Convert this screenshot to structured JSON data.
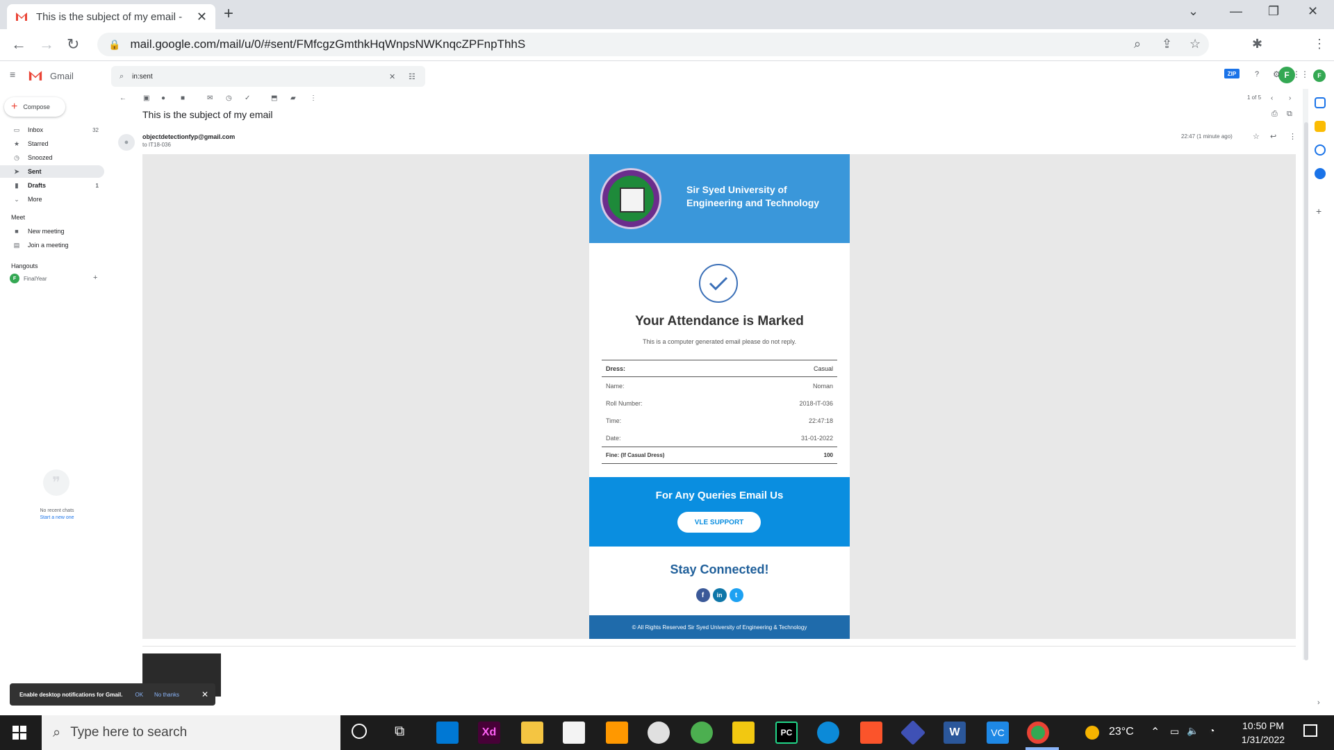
{
  "browser": {
    "tab_title": "This is the subject of my email - ",
    "url": "mail.google.com/mail/u/0/#sent/FMfcgzGmthkHqWnpsNWKnqcZPFnpThhS",
    "profile_initial": "F",
    "zip_badge": "ZIP"
  },
  "gmail": {
    "logo_text": "Gmail",
    "search_value": "in:sent",
    "compose_label": "Compose",
    "nav": [
      {
        "label": "Inbox",
        "count": "32"
      },
      {
        "label": "Starred",
        "count": ""
      },
      {
        "label": "Snoozed",
        "count": ""
      },
      {
        "label": "Sent",
        "count": ""
      },
      {
        "label": "Drafts",
        "count": "1"
      },
      {
        "label": "More",
        "count": ""
      }
    ],
    "meet_header": "Meet",
    "meet_items": [
      "New meeting",
      "Join a meeting"
    ],
    "hangouts_header": "Hangouts",
    "hangouts_user": "FinalYear",
    "no_chats": "No recent chats",
    "start_new": "Start a new one",
    "pager": "1 of 5"
  },
  "message": {
    "subject": "This is the subject of my email",
    "sender": "objectdetectionfyp@gmail.com",
    "recipient": "to IT18-036",
    "time": "22:47 (1 minute ago)"
  },
  "email": {
    "university": "Sir Syed University of Engineering and Technology",
    "heading": "Your Attendance is Marked",
    "note": "This is a computer generated email please do not reply.",
    "rows": [
      {
        "label": "Dress:",
        "value": "Casual"
      },
      {
        "label": "Name:",
        "value": "Noman"
      },
      {
        "label": "Roll Number:",
        "value": "2018-IT-036"
      },
      {
        "label": "Time:",
        "value": "22:47:18"
      },
      {
        "label": "Date:",
        "value": "31-01-2022"
      },
      {
        "label": "Fine: (If Casual Dress)",
        "value": "100"
      }
    ],
    "query_title": "For Any Queries Email Us",
    "support_button": "VLE SUPPORT",
    "stay_connected": "Stay Connected!",
    "footer": "© All Rights Reserved Sir Syed University of Engineering & Technology"
  },
  "notification": {
    "text": "Enable desktop notifications for Gmail.",
    "ok": "OK",
    "no_thanks": "No thanks"
  },
  "taskbar": {
    "search_placeholder": "Type here to search",
    "temperature": "23°C",
    "time": "10:50 PM",
    "date": "1/31/2022"
  },
  "colors": {
    "header_blue": "#3a97da",
    "query_blue": "#0a8ee0",
    "footer_blue": "#1f6bab",
    "gmail_red": "#ea4335"
  }
}
